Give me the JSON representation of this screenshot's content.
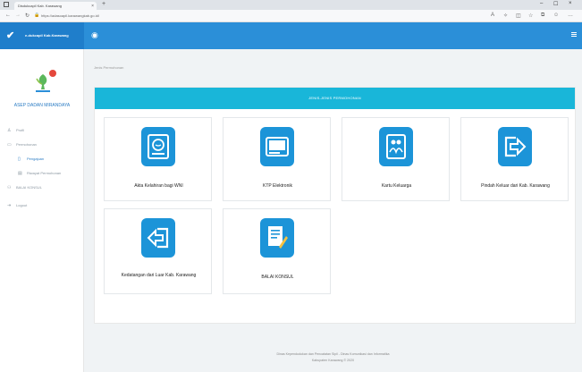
{
  "browser": {
    "tab_title": "Disdukcapil Kab. Karawang",
    "tab_close": "×",
    "new_tab": "+",
    "address": "https://adasoapil.karawangkab.go.id/",
    "controls": [
      "–",
      "☐",
      "×"
    ]
  },
  "app": {
    "brand": "e-dukcapil Kab.Karawang",
    "user_name": "ASEP DADAN MIRANDAYA"
  },
  "sidebar": {
    "items": [
      {
        "label": "Profil",
        "icon": "person-icon"
      },
      {
        "label": "Permohonan",
        "icon": "monitor-icon"
      },
      {
        "label": "Pengajuan",
        "icon": "document-icon"
      },
      {
        "label": "Riwayat Permohonan",
        "icon": "list-icon"
      },
      {
        "label": "BALAI KONSUL",
        "icon": "people-icon"
      },
      {
        "label": "Logout",
        "icon": "logout-icon"
      }
    ]
  },
  "breadcrumb": "Jenis Permohonan",
  "panel": {
    "title": "JENIS-JENIS PERMOHONAN"
  },
  "cards": [
    {
      "label": "Akta Kelahiran bagi WNI",
      "icon": "baby-icon"
    },
    {
      "label": "KTP Elektronik",
      "icon": "id-card-icon"
    },
    {
      "label": "Kartu Keluarga",
      "icon": "family-icon"
    },
    {
      "label": "Pindah Keluar dari Kab. Karawang",
      "icon": "move-out-icon"
    },
    {
      "label": "Kedatangan dari Luar Kab. Karawang",
      "icon": "move-in-icon"
    },
    {
      "label": "BALAI KONSUL",
      "icon": "consult-document-icon"
    }
  ],
  "footer": {
    "line1": "Dinas Kependudukan dan Pencatatan Sipil - Dinas Komunikasi dan Informatika",
    "line2": "Kabupaten Karawang © 2020"
  },
  "colors": {
    "header_dark": "#1f7ecb",
    "header": "#2b8fd8",
    "panel_head": "#19b6d9",
    "icon_blue": "#1c94d8",
    "active_link": "#2b7cc4"
  }
}
